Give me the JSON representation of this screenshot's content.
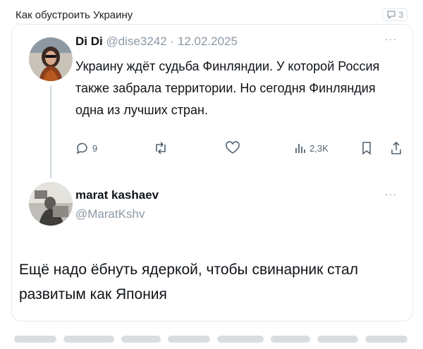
{
  "header": {
    "title": "Как обустроить Украину",
    "badge_count": "3"
  },
  "quoted_tweet": {
    "display_name": "Di Di",
    "handle": "@dise3242",
    "separator": "·",
    "date": "12.02.2025",
    "text": "Украину ждёт судьба Финляндии. У которой Россия также забрала территории. Но сегодня Финляндия одна из лучших стран.",
    "replies": "9",
    "views": "2,3K"
  },
  "reply_tweet": {
    "display_name": "marat kashaev",
    "handle": "@MaratKshv",
    "text": "Ещё надо ёбнуть ядеркой, чтобы свинарник стал развитым как Япония"
  },
  "more_label": "···"
}
